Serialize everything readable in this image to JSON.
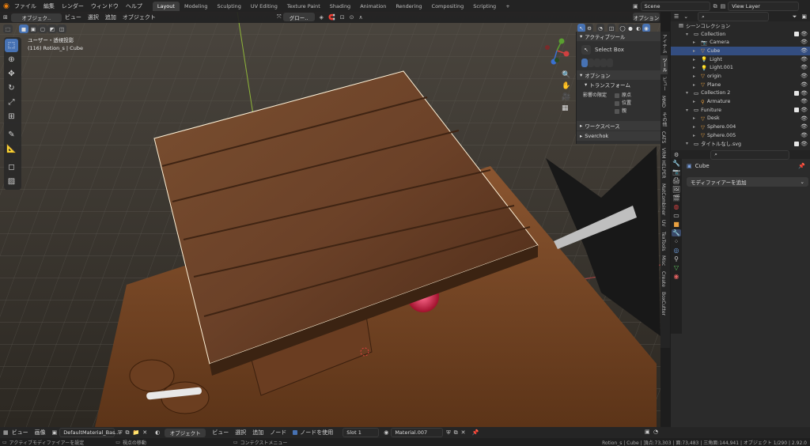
{
  "topbar": {
    "menus": [
      "ファイル",
      "編集",
      "レンダー",
      "ウィンドウ",
      "ヘルプ"
    ],
    "workspaces": [
      "Layout",
      "Modeling",
      "Sculpting",
      "UV Editing",
      "Texture Paint",
      "Shading",
      "Animation",
      "Rendering",
      "Compositing",
      "Scripting"
    ],
    "active_workspace": "Layout",
    "add_tab": "+",
    "scene": "Scene",
    "view_layer": "View Layer"
  },
  "viewport_header": {
    "mode": "オブジェク..",
    "menus": [
      "ビュー",
      "選択",
      "追加",
      "オブジェクト"
    ],
    "transform_orientation": "グロー..",
    "options": "オプション"
  },
  "viewport": {
    "view_name": "ユーザー・透視投影",
    "object_info": "(116) Rotion_s | Cube"
  },
  "npanel": {
    "active_tool_title": "アクティブツール",
    "tool_name": "Select Box",
    "options_title": "オプション",
    "transform_label": "トランスフォーム",
    "affect_only": "影響の限定",
    "opt_origins": "原点",
    "opt_locations": "位置",
    "opt_parents": "親",
    "workspace_label": "ワークスペース",
    "sverchok_label": "Sverchok"
  },
  "vtabs": [
    "アイテム",
    "ツール",
    "ビュー",
    "MMD",
    "その他",
    "CATS",
    "VRM HELPER",
    "MatCombiner",
    "UV",
    "TexTools",
    "Misc",
    "Create",
    "BoxCutter"
  ],
  "outliner": {
    "root": "シーンコレクション",
    "rows": [
      {
        "label": "Collection",
        "indent": 1,
        "icon": "collection"
      },
      {
        "label": "Camera",
        "indent": 2,
        "icon": "camera"
      },
      {
        "label": "Cube",
        "indent": 2,
        "icon": "mesh",
        "selected": true
      },
      {
        "label": "Light",
        "indent": 2,
        "icon": "light"
      },
      {
        "label": "Light.001",
        "indent": 2,
        "icon": "light"
      },
      {
        "label": "origin",
        "indent": 2,
        "icon": "mesh"
      },
      {
        "label": "Plane",
        "indent": 2,
        "icon": "mesh"
      },
      {
        "label": "Collection 2",
        "indent": 1,
        "icon": "collection"
      },
      {
        "label": "Armature",
        "indent": 2,
        "icon": "armature"
      },
      {
        "label": "Funiture",
        "indent": 1,
        "icon": "collection"
      },
      {
        "label": "Desk",
        "indent": 2,
        "icon": "mesh"
      },
      {
        "label": "Sphere.004",
        "indent": 2,
        "icon": "mesh"
      },
      {
        "label": "Sphere.005",
        "indent": 2,
        "icon": "mesh"
      },
      {
        "label": "タイトルなし.svg",
        "indent": 1,
        "icon": "collection"
      }
    ]
  },
  "properties": {
    "object_name": "Cube",
    "add_modifier": "モディファイアーを追加"
  },
  "node_header": {
    "menus_left": [
      "ビュー",
      "画像"
    ],
    "material_slot_name": "DefaultMaterial_Bas...",
    "object_mode": "オブジェクト",
    "menus_right": [
      "ビュー",
      "選択",
      "追加",
      "ノード"
    ],
    "use_nodes": "ノードを使用",
    "slot": "Slot 1",
    "material": "Material.007"
  },
  "statusbar": {
    "left_hint": "アクティブモディファイアーを設定",
    "middle_hint": "視点の移動",
    "right_hint": "コンテクストメニュー",
    "stats": "Rotion_s | Cube | 頂点:73,303 | 面:73,483 | 三角面:144,941 | オブジェクト 1/290 | 2.92.0"
  },
  "colors": {
    "accent": "#4772b3",
    "selected_row": "#334d80",
    "header_bg": "#232323"
  }
}
